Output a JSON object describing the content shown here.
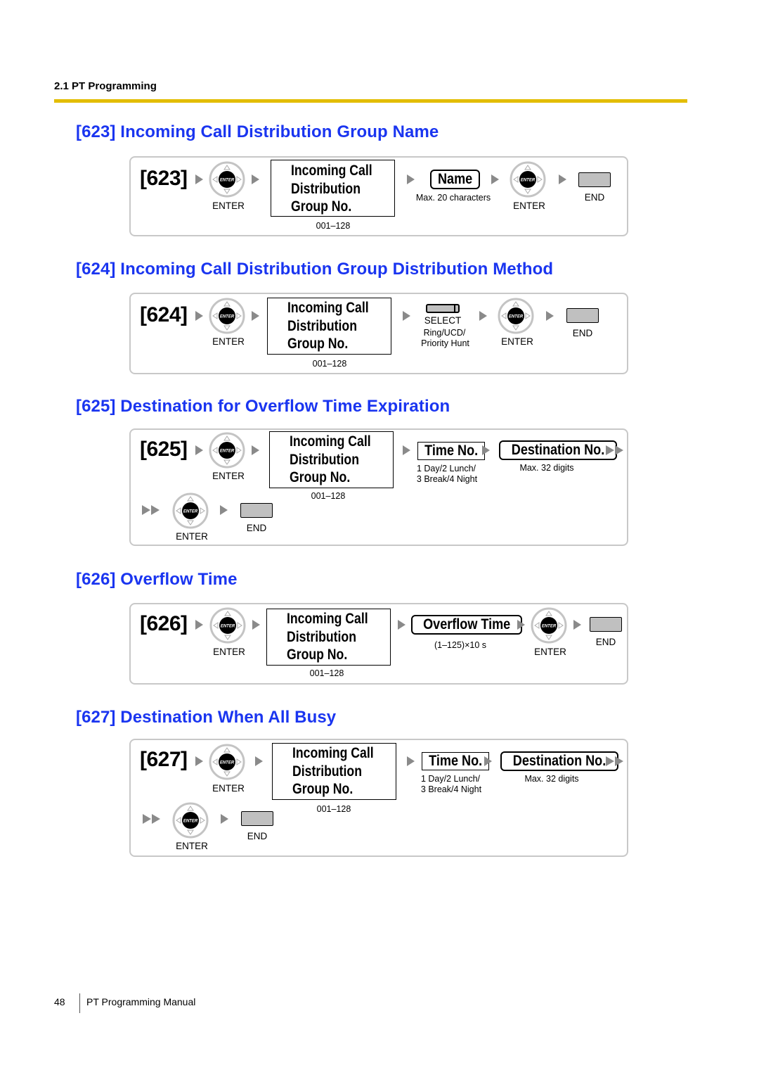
{
  "header": {
    "section": "2.1 PT Programming",
    "rule_color": "#e3bd00"
  },
  "accent_color": "#1a35f0",
  "common": {
    "enter_label": "ENTER",
    "end_label": "END",
    "lcd_lines": [
      "Incoming Call",
      "Distribution",
      "Group No."
    ],
    "group_range": "001–128",
    "enter_icon": "enter-navigator-key-icon",
    "end_icon": "end-key-icon",
    "arrow_icon": "right-triangle-arrow-icon"
  },
  "sections": [
    {
      "code": "[623]",
      "title": "[623] Incoming Call Distribution Group Name",
      "entry": "Name",
      "entry_note": "Max. 20 characters"
    },
    {
      "code": "[624]",
      "title": "[624] Incoming Call Distribution Group Distribution Method",
      "select_label": "SELECT",
      "select_note_1": "Ring/UCD/",
      "select_note_2": "Priority Hunt"
    },
    {
      "code": "[625]",
      "title": "[625] Destination for Overflow Time Expiration",
      "time_box": "Time No.",
      "time_note_1": "1 Day/2 Lunch/",
      "time_note_2": "3 Break/4 Night",
      "dest_box": "Destination No.",
      "dest_note": "Max. 32 digits"
    },
    {
      "code": "[626]",
      "title": "[626] Overflow Time",
      "entry": "Overflow Time",
      "entry_note": "(1–125)×10 s"
    },
    {
      "code": "[627]",
      "title": "[627] Destination When All Busy",
      "time_box": "Time No.",
      "time_note_1": "1 Day/2 Lunch/",
      "time_note_2": "3 Break/4 Night",
      "dest_box": "Destination No.",
      "dest_note": "Max. 32 digits"
    }
  ],
  "footer": {
    "page_number": "48",
    "manual_title": "PT Programming Manual"
  }
}
